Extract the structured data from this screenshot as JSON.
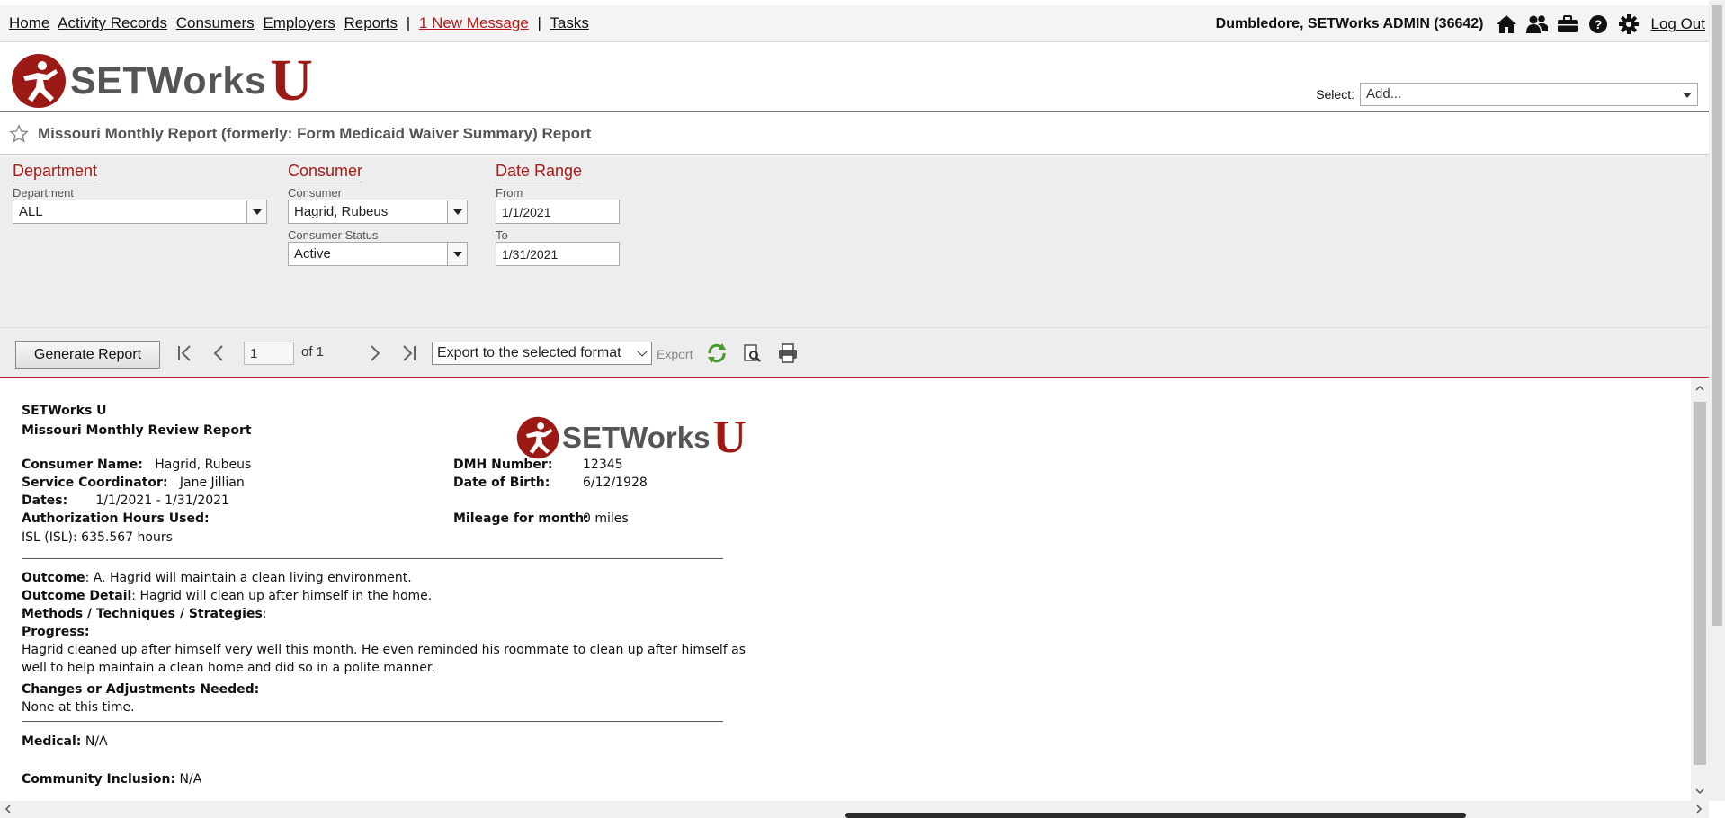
{
  "nav": {
    "links": [
      "Home",
      "Activity Records",
      "Consumers",
      "Employers",
      "Reports"
    ],
    "message_link": "1 New Message",
    "tasks_link": "Tasks",
    "user": "Dumbledore, SETWorks ADMIN  (36642)",
    "icons": [
      "home-icon",
      "users-icon",
      "briefcase-icon",
      "help-icon",
      "gear-icon"
    ],
    "logout": "Log Out"
  },
  "header": {
    "logo_word": "SETWorks",
    "logo_u": "U",
    "select_label": "Select:",
    "select_value": "Add..."
  },
  "page": {
    "title": "Missouri Monthly Report (formerly: Form Medicaid Waiver Summary) Report"
  },
  "filters": {
    "department": {
      "title": "Department",
      "label": "Department",
      "value": "ALL"
    },
    "consumer": {
      "title": "Consumer",
      "label": "Consumer",
      "value": "Hagrid, Rubeus",
      "status_label": "Consumer Status",
      "status_value": "Active"
    },
    "date_range": {
      "title": "Date Range",
      "from_label": "From",
      "from_value": "1/1/2021",
      "to_label": "To",
      "to_value": "1/31/2021"
    }
  },
  "toolbar": {
    "generate": "Generate Report",
    "page": "1",
    "of": "of 1",
    "export_format": "Export to the selected format",
    "export": "Export"
  },
  "report": {
    "org": "SETWorks U",
    "name": "Missouri Monthly Review Report",
    "logo_word": "SETWorks",
    "logo_u": "U",
    "consumer_name_label": "Consumer Name:",
    "consumer_name": "Hagrid, Rubeus",
    "coordinator_label": "Service Coordinator:",
    "coordinator": "Jane Jillian",
    "dates_label": "Dates:",
    "dates": "1/1/2021 - 1/31/2021",
    "auth_label": "Authorization Hours Used:",
    "auth_value": "ISL (ISL): 635.567 hours",
    "dmh_label": "DMH Number:",
    "dmh": "12345",
    "dob_label": "Date of Birth:",
    "dob": "6/12/1928",
    "mileage_label": "Mileage for month:",
    "mileage": "0 miles",
    "outcome_label": "Outcome",
    "outcome": ": A. Hagrid will maintain a clean living environment.",
    "outcome_detail_label": "Outcome Detail",
    "outcome_detail": ": Hagrid will clean up after himself in the home.",
    "methods_label": "Methods / Techniques / Strategies",
    "methods": ":",
    "progress_label": "Progress:",
    "progress_1": "Hagrid cleaned up after himself very well this month. He even reminded his roommate to clean up after himself as",
    "progress_2": "well to help maintain a clean home and did so in a polite manner.",
    "changes_label": "Changes or Adjustments Needed:",
    "changes": "None at this time.",
    "medical_label": "Medical:",
    "medical": "N/A",
    "community_label": "Community Inclusion:",
    "community": "N/A"
  },
  "colors": {
    "brand_red": "#9b1a16",
    "section_red": "#a51d18",
    "panel_gray": "#ededed"
  }
}
